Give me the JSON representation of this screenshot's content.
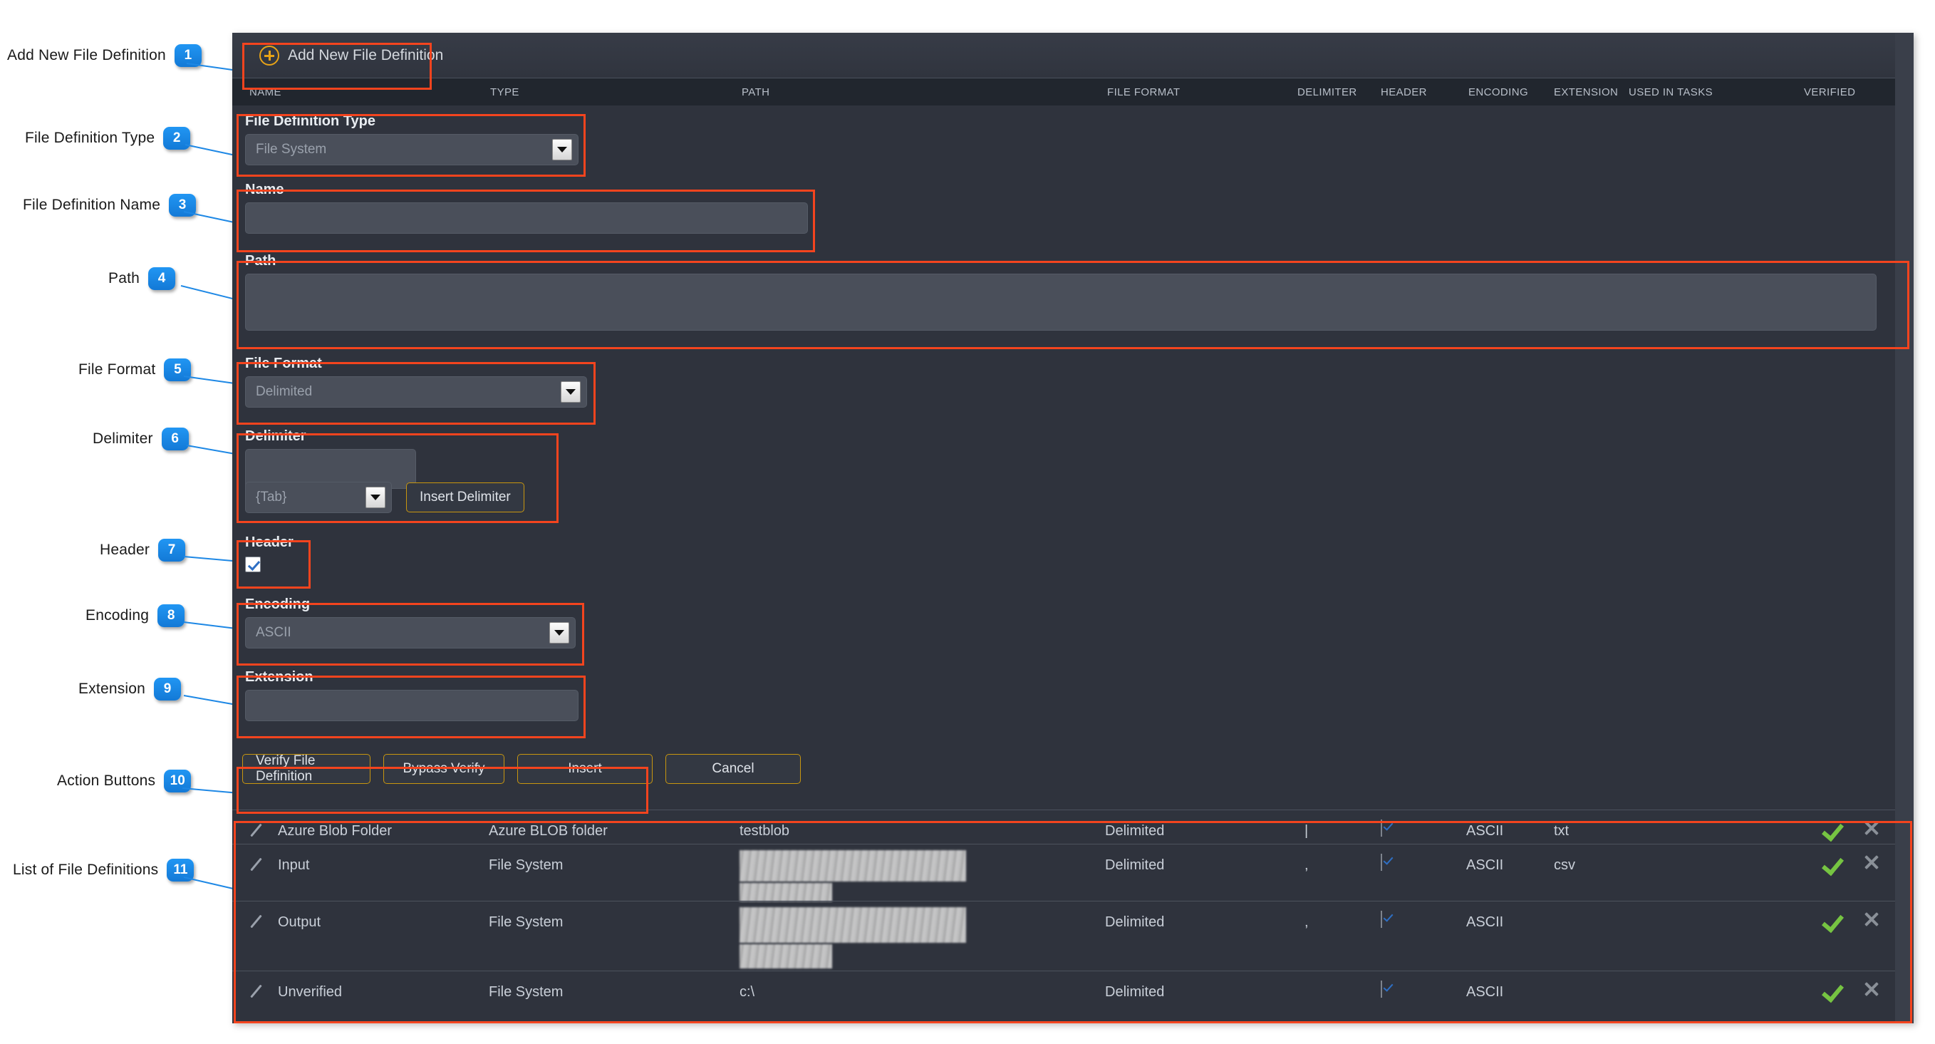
{
  "annotations": [
    {
      "n": "1",
      "label": "Add New File Definition"
    },
    {
      "n": "2",
      "label": "File Definition Type"
    },
    {
      "n": "3",
      "label": "File Definition Name"
    },
    {
      "n": "4",
      "label": "Path"
    },
    {
      "n": "5",
      "label": "File Format"
    },
    {
      "n": "6",
      "label": "Delimiter"
    },
    {
      "n": "7",
      "label": "Header"
    },
    {
      "n": "8",
      "label": "Encoding"
    },
    {
      "n": "9",
      "label": "Extension"
    },
    {
      "n": "10",
      "label": "Action Buttons"
    },
    {
      "n": "11",
      "label": "List of File Definitions"
    }
  ],
  "toolbar": {
    "add_label": "Add New File Definition",
    "add_icon": "plus-circle-icon"
  },
  "columns": [
    {
      "key": "name",
      "label": "NAME"
    },
    {
      "key": "type",
      "label": "TYPE"
    },
    {
      "key": "path",
      "label": "PATH"
    },
    {
      "key": "file_format",
      "label": "FILE FORMAT"
    },
    {
      "key": "delimiter",
      "label": "DELIMITER"
    },
    {
      "key": "header",
      "label": "HEADER"
    },
    {
      "key": "encoding",
      "label": "ENCODING"
    },
    {
      "key": "extension",
      "label": "EXTENSION"
    },
    {
      "key": "used_tasks",
      "label": "USED IN TASKS"
    },
    {
      "key": "verified",
      "label": "VERIFIED"
    }
  ],
  "form": {
    "file_definition_type": {
      "label": "File Definition Type",
      "value": "File System"
    },
    "name": {
      "label": "Name",
      "value": ""
    },
    "path": {
      "label": "Path",
      "value": ""
    },
    "file_format": {
      "label": "File Format",
      "value": "Delimited"
    },
    "delimiter": {
      "label": "Delimiter",
      "value": "",
      "select_value": "{Tab}",
      "insert_label": "Insert Delimiter"
    },
    "header": {
      "label": "Header",
      "checked": true
    },
    "encoding": {
      "label": "Encoding",
      "value": "ASCII"
    },
    "extension": {
      "label": "Extension",
      "value": ""
    }
  },
  "actions": [
    {
      "label": "Verify File Definition"
    },
    {
      "label": "Bypass Verify"
    },
    {
      "label": "Insert"
    },
    {
      "label": "Cancel"
    }
  ],
  "rows": [
    {
      "name": "Azure Blob Folder",
      "type": "Azure BLOB folder",
      "path": "testblob",
      "path_redacted": false,
      "file_format": "Delimited",
      "delimiter": "|",
      "header": true,
      "encoding": "ASCII",
      "extension": "txt",
      "used_tasks": "",
      "verified": true
    },
    {
      "name": "Input",
      "type": "File System",
      "path": "",
      "path_redacted": true,
      "file_format": "Delimited",
      "delimiter": ",",
      "header": true,
      "encoding": "ASCII",
      "extension": "csv",
      "used_tasks": "",
      "verified": true
    },
    {
      "name": "Output",
      "type": "File System",
      "path": "",
      "path_redacted": true,
      "file_format": "Delimited",
      "delimiter": ",",
      "header": true,
      "encoding": "ASCII",
      "extension": "",
      "used_tasks": "",
      "verified": true
    },
    {
      "name": "Unverified",
      "type": "File System",
      "path": "c:\\",
      "path_redacted": false,
      "file_format": "Delimited",
      "delimiter": "",
      "header": true,
      "encoding": "ASCII",
      "extension": "",
      "used_tasks": "",
      "verified": true
    }
  ],
  "colors": {
    "highlight": "#f4441e",
    "badge": "#2196f3",
    "accent_gold": "#e8a317",
    "verified_green": "#76c442",
    "app_bg": "#2f333d",
    "header_bg": "#21262e"
  }
}
